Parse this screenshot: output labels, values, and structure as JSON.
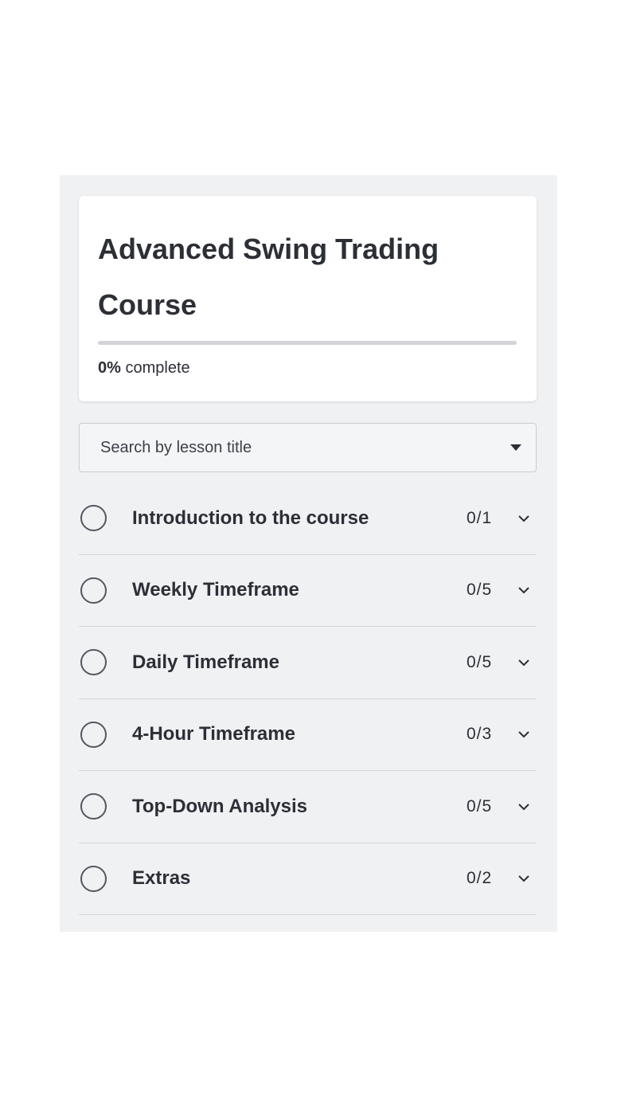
{
  "course": {
    "title": "Advanced Swing Trading Course",
    "progress_value": "0%",
    "progress_suffix": "complete",
    "progress_fraction": 0
  },
  "search": {
    "placeholder": "Search by lesson title",
    "icon": "caret-down-icon"
  },
  "lessons": [
    {
      "title": "Introduction to the course",
      "count": "0/1",
      "status_icon": "empty-circle-icon",
      "toggle_icon": "chevron-down-icon"
    },
    {
      "title": "Weekly Timeframe",
      "count": "0/5",
      "status_icon": "empty-circle-icon",
      "toggle_icon": "chevron-down-icon"
    },
    {
      "title": "Daily Timeframe",
      "count": "0/5",
      "status_icon": "empty-circle-icon",
      "toggle_icon": "chevron-down-icon"
    },
    {
      "title": "4-Hour Timeframe",
      "count": "0/3",
      "status_icon": "empty-circle-icon",
      "toggle_icon": "chevron-down-icon"
    },
    {
      "title": "Top-Down Analysis",
      "count": "0/5",
      "status_icon": "empty-circle-icon",
      "toggle_icon": "chevron-down-icon"
    },
    {
      "title": "Extras",
      "count": "0/2",
      "status_icon": "empty-circle-icon",
      "toggle_icon": "chevron-down-icon"
    }
  ],
  "colors": {
    "panel_bg": "#f0f1f3",
    "text": "#2d2f36",
    "progress_track": "#d2d4d9"
  }
}
